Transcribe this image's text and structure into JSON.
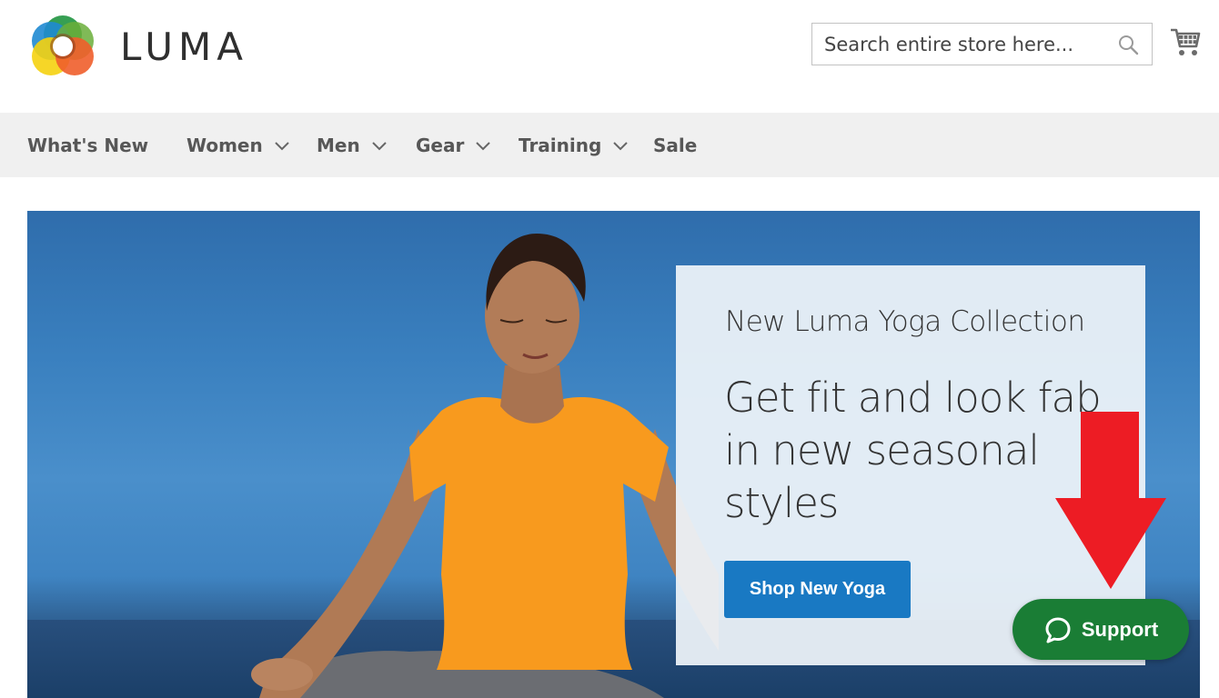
{
  "brand": {
    "name": "LUMA"
  },
  "search": {
    "placeholder": "Search entire store here..."
  },
  "nav": {
    "items": [
      {
        "label": "What's New",
        "has_dropdown": false
      },
      {
        "label": "Women",
        "has_dropdown": true
      },
      {
        "label": "Men",
        "has_dropdown": true
      },
      {
        "label": "Gear",
        "has_dropdown": true
      },
      {
        "label": "Training",
        "has_dropdown": true
      },
      {
        "label": "Sale",
        "has_dropdown": false
      }
    ]
  },
  "hero": {
    "subtitle": "New Luma Yoga Collection",
    "title": "Get fit and look fab in new seasonal styles",
    "cta_label": "Shop New Yoga"
  },
  "support": {
    "label": "Support",
    "color": "#1a7d35"
  },
  "colors": {
    "accent": "#1979c3",
    "nav_bg": "#f0f0f0",
    "annotation_arrow": "#ed1c24"
  },
  "icons": [
    "luma-logo",
    "search-icon",
    "cart-icon",
    "chevron-down-icon",
    "chat-bubble-icon",
    "red-arrow-annotation"
  ]
}
